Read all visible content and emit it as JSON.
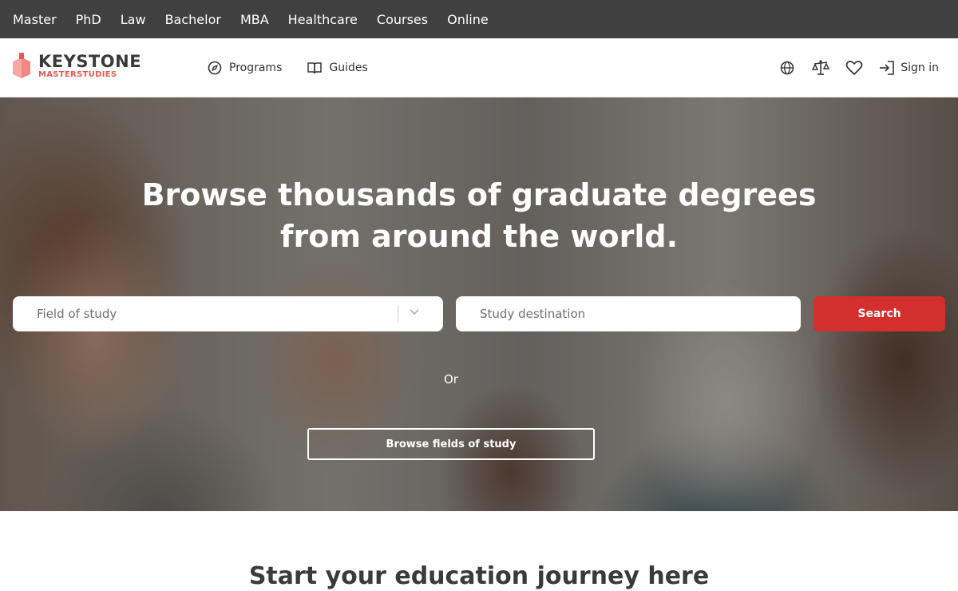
{
  "topbar": {
    "items": [
      "Master",
      "PhD",
      "Law",
      "Bachelor",
      "MBA",
      "Healthcare",
      "Courses",
      "Online"
    ]
  },
  "header": {
    "logo_main": "KEYSTONE",
    "logo_sub": "MASTERSTUDIES",
    "nav": [
      {
        "label": "Programs",
        "icon": "compass-icon"
      },
      {
        "label": "Guides",
        "icon": "book-open-icon"
      }
    ],
    "right_icons": [
      "globe-icon",
      "compare-scale-icon",
      "heart-icon"
    ],
    "signin_label": "Sign in"
  },
  "hero": {
    "title": "Browse thousands of graduate degrees from around the world.",
    "field_of_study_placeholder": "Field of study",
    "destination_placeholder": "Study destination",
    "search_label": "Search",
    "or_text": "Or",
    "browse_label": "Browse fields of study"
  },
  "section": {
    "heading": "Start your education journey here"
  },
  "colors": {
    "topbar_bg": "#404040",
    "brand_accent": "#e45b56",
    "search_button": "#d32f2f"
  }
}
